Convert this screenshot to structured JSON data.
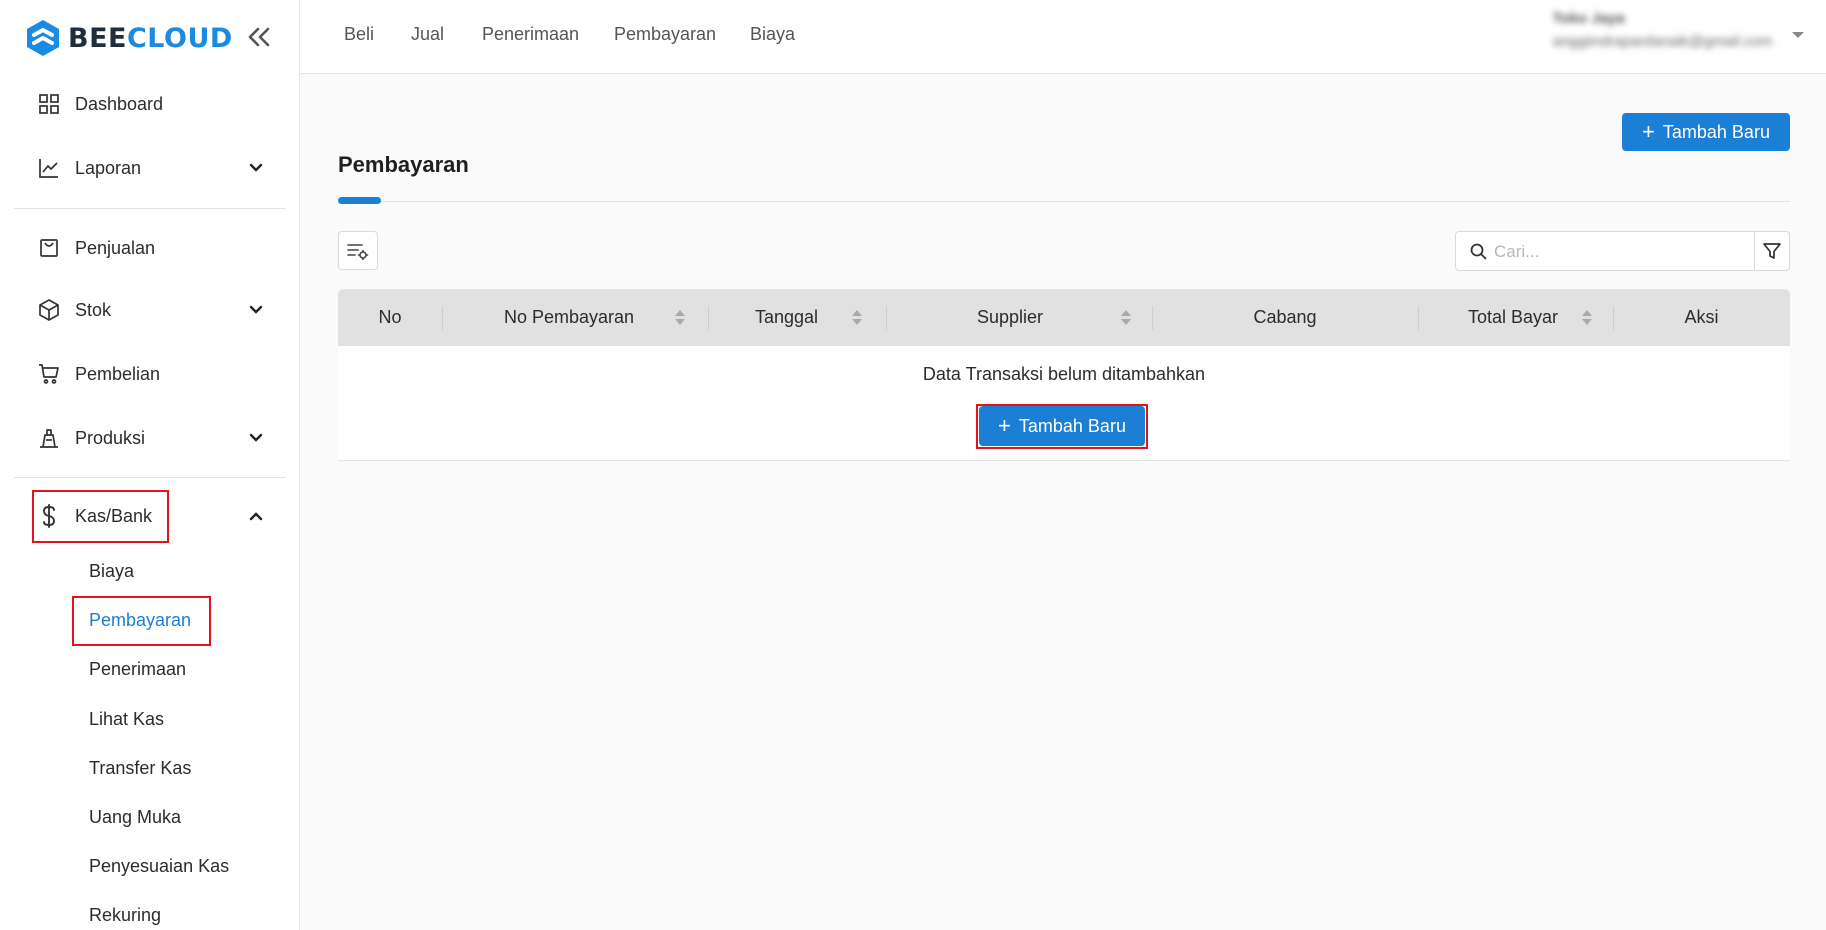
{
  "brand": {
    "part1": "BEE",
    "part2": "CLOUD"
  },
  "sidebar": {
    "items": [
      {
        "label": "Dashboard",
        "icon": "grid-icon"
      },
      {
        "label": "Laporan",
        "icon": "chart-line-icon"
      },
      {
        "label": "Penjualan",
        "icon": "shopping-bag-icon"
      },
      {
        "label": "Stok",
        "icon": "box-icon"
      },
      {
        "label": "Pembelian",
        "icon": "cart-icon"
      },
      {
        "label": "Produksi",
        "icon": "factory-icon"
      },
      {
        "label": "Kas/Bank",
        "icon": "dollar-icon"
      }
    ],
    "submenu": [
      "Biaya",
      "Pembayaran",
      "Penerimaan",
      "Lihat Kas",
      "Transfer Kas",
      "Uang Muka",
      "Penyesuaian Kas",
      "Rekuring"
    ],
    "active_sub": "Pembayaran"
  },
  "topnav": [
    "Beli",
    "Jual",
    "Penerimaan",
    "Pembayaran",
    "Biaya"
  ],
  "user": {
    "name": "Toko Jaya",
    "email": "anggiindrapardanaik@gmail.com"
  },
  "main": {
    "add_button": "Tambah Baru",
    "title": "Pembayaran",
    "search_placeholder": "Cari...",
    "columns": [
      "No",
      "No Pembayaran",
      "Tanggal",
      "Supplier",
      "Cabang",
      "Total Bayar",
      "Aksi"
    ],
    "empty_message": "Data Transaksi belum ditambahkan",
    "empty_add_button": "Tambah Baru"
  },
  "colors": {
    "accent": "#1b7fd6",
    "highlight": "#e3131b",
    "header_bg": "#e1e1e1"
  }
}
